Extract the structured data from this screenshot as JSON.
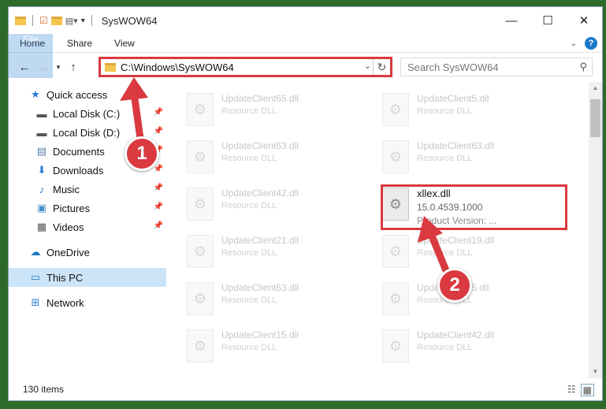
{
  "window": {
    "title": "SysWOW64"
  },
  "ribbon": {
    "tabs": [
      "File",
      "Home",
      "Share",
      "View"
    ]
  },
  "address": {
    "path": "C:\\Windows\\SysWOW64"
  },
  "search": {
    "placeholder": "Search SysWOW64"
  },
  "sidebar": {
    "quick_access": "Quick access",
    "items": [
      {
        "label": "Local Disk (C:)",
        "icon": "drive-icon"
      },
      {
        "label": "Local Disk (D:)",
        "icon": "drive-icon"
      },
      {
        "label": "Documents",
        "icon": "documents-icon"
      },
      {
        "label": "Downloads",
        "icon": "downloads-icon"
      },
      {
        "label": "Music",
        "icon": "music-icon"
      },
      {
        "label": "Pictures",
        "icon": "pictures-icon"
      },
      {
        "label": "Videos",
        "icon": "videos-icon"
      }
    ],
    "onedrive": "OneDrive",
    "this_pc": "This PC",
    "network": "Network"
  },
  "files": [
    {
      "name": "UpdateClient65.dll",
      "desc": "Resource DLL"
    },
    {
      "name": "UpdateClient5.dll",
      "desc": "Resource DLL"
    },
    {
      "name": "UpdateClient63.dll",
      "desc": "Resource DLL"
    },
    {
      "name": "UpdateClient63.dll",
      "desc": "Resource DLL"
    },
    {
      "name": "UpdateClient42.dll",
      "desc": "Resource DLL"
    },
    {
      "name": "xllex.dll",
      "desc": "15.0.4539.1000",
      "desc2": "Product Version:     ..."
    },
    {
      "name": "UpdateClient21.dll",
      "desc": "Resource DLL"
    },
    {
      "name": "UpdateClient19.dll",
      "desc": "Resource DLL"
    },
    {
      "name": "UpdateClient63.dll",
      "desc": "Resource DLL"
    },
    {
      "name": "UpdateClient5.dll",
      "desc": "Resource DLL"
    },
    {
      "name": "UpdateClient15.dll",
      "desc": "Resource DLL"
    },
    {
      "name": "UpdateClient42.dll",
      "desc": "Resource DLL"
    }
  ],
  "status": {
    "count": "130 items"
  },
  "annotations": {
    "step1": "1",
    "step2": "2"
  },
  "colors": {
    "accent": "#1979ca",
    "highlight": "#d9393f"
  }
}
